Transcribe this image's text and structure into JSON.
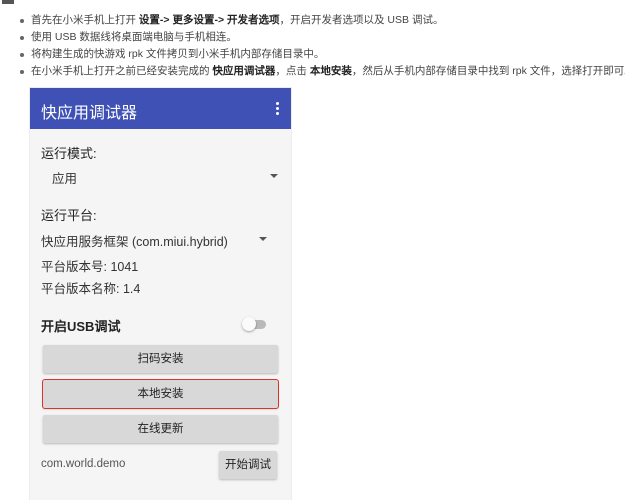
{
  "steps": [
    {
      "parts": [
        {
          "t": "首先在小米手机上打开 ",
          "b": false
        },
        {
          "t": "设置-> 更多设置-> 开发者选项",
          "b": true
        },
        {
          "t": "，开启开发者选项以及 USB 调试。",
          "b": false
        }
      ]
    },
    {
      "parts": [
        {
          "t": "使用 USB 数据线将桌面端电脑与手机相连。",
          "b": false
        }
      ]
    },
    {
      "parts": [
        {
          "t": "将构建生成的快游戏 rpk 文件拷贝到小米手机内部存储目录中。",
          "b": false
        }
      ]
    },
    {
      "parts": [
        {
          "t": "在小米手机上打开之前已经安装完成的 ",
          "b": false
        },
        {
          "t": "快应用调试器",
          "b": true
        },
        {
          "t": "，点击 ",
          "b": false
        },
        {
          "t": "本地安装",
          "b": true
        },
        {
          "t": "，然后从手机内部存储目录中找到 rpk 文件，选择打开即可。",
          "b": false
        }
      ]
    }
  ],
  "app": {
    "title": "快应用调试器",
    "run_mode_label": "运行模式:",
    "run_mode_value": "应用",
    "platform_label": "运行平台:",
    "platform_value": "快应用服务框架 (com.miui.hybrid)",
    "platform_version_code": "平台版本号: 1041",
    "platform_version_name": "平台版本名称: 1.4",
    "usb_debug_label": "开启USB调试",
    "usb_debug_enabled": false,
    "scan_install": "扫码安装",
    "local_install": "本地安装",
    "online_update": "在线更新",
    "package_name": "com.world.demo",
    "start_debug": "开始调试"
  },
  "colors": {
    "appbar": "#3f51b5",
    "highlight_border": "#d9342b",
    "button_bg": "#d8d8d8"
  }
}
